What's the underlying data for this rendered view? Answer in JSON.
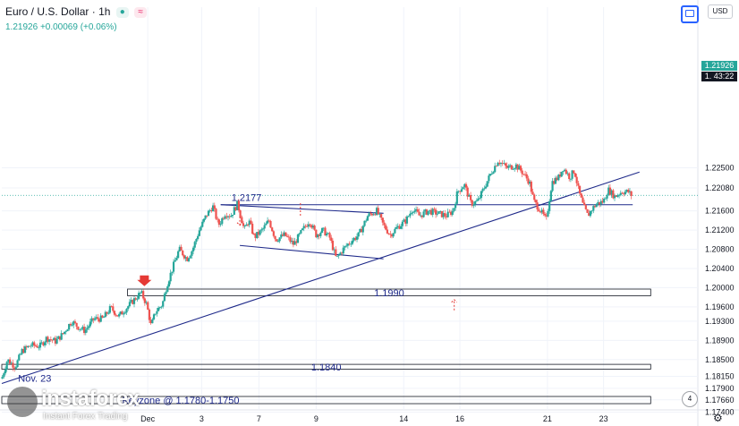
{
  "header": {
    "symbol": "Euro / U.S. Dollar",
    "sep": "·",
    "interval": "1h",
    "price": "1.21926",
    "change": "+0.00069 (+0.06%)",
    "dot_icon": "●",
    "wave_icon": "≈"
  },
  "toolbar": {
    "currency": "USD"
  },
  "price_label": {
    "price": "1.21926",
    "timer_prefix": "1.",
    "timer": "43:22"
  },
  "branding": {
    "name": "instaforex",
    "tagline": "Instant Forex Trading"
  },
  "badge": {
    "count": "4"
  },
  "chart_data": {
    "type": "candlestick",
    "ylim": [
      1.1745,
      1.2585
    ],
    "x_range": [
      0,
      620
    ],
    "y_ticks": [
      "1.22500",
      "1.22080",
      "1.21600",
      "1.21200",
      "1.20800",
      "1.20400",
      "1.20000",
      "1.19600",
      "1.19300",
      "1.18900",
      "1.18500",
      "1.18150",
      "1.17900",
      "1.17660",
      "1.17400"
    ],
    "y_tick_values": [
      1.225,
      1.2208,
      1.216,
      1.212,
      1.208,
      1.204,
      1.2,
      1.196,
      1.193,
      1.189,
      1.185,
      1.1815,
      1.179,
      1.1766,
      1.174
    ],
    "x_ticks": [
      {
        "label": "Dec",
        "t": 130
      },
      {
        "label": "3",
        "t": 178
      },
      {
        "label": "7",
        "t": 229
      },
      {
        "label": "9",
        "t": 280
      },
      {
        "label": "14",
        "t": 358
      },
      {
        "label": "16",
        "t": 408
      },
      {
        "label": "21",
        "t": 486
      },
      {
        "label": "23",
        "t": 536
      }
    ],
    "anchors": [
      [
        0,
        1.181
      ],
      [
        5,
        1.185
      ],
      [
        12,
        1.1835
      ],
      [
        18,
        1.1868
      ],
      [
        26,
        1.188
      ],
      [
        34,
        1.1878
      ],
      [
        40,
        1.1895
      ],
      [
        48,
        1.1888
      ],
      [
        55,
        1.1905
      ],
      [
        62,
        1.193
      ],
      [
        68,
        1.1918
      ],
      [
        74,
        1.191
      ],
      [
        82,
        1.1935
      ],
      [
        90,
        1.1935
      ],
      [
        97,
        1.1958
      ],
      [
        104,
        1.194
      ],
      [
        110,
        1.1955
      ],
      [
        118,
        1.1975
      ],
      [
        124,
        1.199
      ],
      [
        129,
        1.1965
      ],
      [
        133,
        1.192
      ],
      [
        137,
        1.195
      ],
      [
        143,
        1.1965
      ],
      [
        147,
        1.2005
      ],
      [
        152,
        1.204
      ],
      [
        158,
        1.208
      ],
      [
        165,
        1.206
      ],
      [
        170,
        1.208
      ],
      [
        176,
        1.212
      ],
      [
        182,
        1.215
      ],
      [
        188,
        1.217
      ],
      [
        193,
        1.213
      ],
      [
        199,
        1.2155
      ],
      [
        204,
        1.215
      ],
      [
        210,
        1.2175
      ],
      [
        216,
        1.212
      ],
      [
        220,
        1.214
      ],
      [
        225,
        1.2105
      ],
      [
        232,
        1.212
      ],
      [
        238,
        1.214
      ],
      [
        244,
        1.21
      ],
      [
        252,
        1.211
      ],
      [
        260,
        1.209
      ],
      [
        268,
        1.212
      ],
      [
        274,
        1.214
      ],
      [
        280,
        1.211
      ],
      [
        286,
        1.212
      ],
      [
        292,
        1.2105
      ],
      [
        298,
        1.206
      ],
      [
        304,
        1.208
      ],
      [
        310,
        1.2095
      ],
      [
        318,
        1.211
      ],
      [
        326,
        1.215
      ],
      [
        334,
        1.216
      ],
      [
        340,
        1.213
      ],
      [
        346,
        1.211
      ],
      [
        352,
        1.2125
      ],
      [
        360,
        1.214
      ],
      [
        366,
        1.2165
      ],
      [
        372,
        1.215
      ],
      [
        380,
        1.216
      ],
      [
        388,
        1.2155
      ],
      [
        396,
        1.215
      ],
      [
        402,
        1.216
      ],
      [
        406,
        1.22
      ],
      [
        412,
        1.2215
      ],
      [
        418,
        1.2175
      ],
      [
        424,
        1.218
      ],
      [
        430,
        1.221
      ],
      [
        436,
        1.224
      ],
      [
        442,
        1.2265
      ],
      [
        450,
        1.225
      ],
      [
        458,
        1.2255
      ],
      [
        464,
        1.224
      ],
      [
        470,
        1.222
      ],
      [
        474,
        1.218
      ],
      [
        480,
        1.216
      ],
      [
        485,
        1.214
      ],
      [
        490,
        1.222
      ],
      [
        496,
        1.223
      ],
      [
        500,
        1.225
      ],
      [
        506,
        1.223
      ],
      [
        510,
        1.2245
      ],
      [
        514,
        1.22
      ],
      [
        518,
        1.217
      ],
      [
        522,
        1.215
      ],
      [
        526,
        1.2165
      ],
      [
        530,
        1.2175
      ],
      [
        536,
        1.218
      ],
      [
        540,
        1.2205
      ],
      [
        546,
        1.219
      ],
      [
        552,
        1.22
      ],
      [
        558,
        1.22
      ],
      [
        562,
        1.219
      ]
    ],
    "levels": [
      {
        "label": "1.2177",
        "value": 1.2173,
        "t0": 195,
        "t1": 562
      },
      {
        "label": "1.1990",
        "value_top": 1.1997,
        "value_bottom": 1.1983,
        "t0": 112,
        "t1": 578
      },
      {
        "label": "1.1840",
        "value_top": 1.184,
        "value_bottom": 1.183,
        "t0": 0,
        "t1": 578
      },
      {
        "label": "Keyzone @ 1.1780-1.1750",
        "value_top": 1.1773,
        "value_bottom": 1.1758,
        "t0": 0,
        "t1": 578
      }
    ],
    "trendlines": [
      {
        "name": "ascending",
        "p0": [
          0,
          1.18
        ],
        "p1": [
          568,
          1.2241
        ]
      },
      {
        "name": "channel-top",
        "p0": [
          195,
          1.2173
        ],
        "p1": [
          340,
          1.2155
        ]
      },
      {
        "name": "channel-bottom",
        "p0": [
          212,
          1.2088
        ],
        "p1": [
          340,
          1.206
        ]
      }
    ],
    "annotations": [
      {
        "label": "Nov. 23",
        "t": 5,
        "value": 1.1811
      }
    ]
  }
}
